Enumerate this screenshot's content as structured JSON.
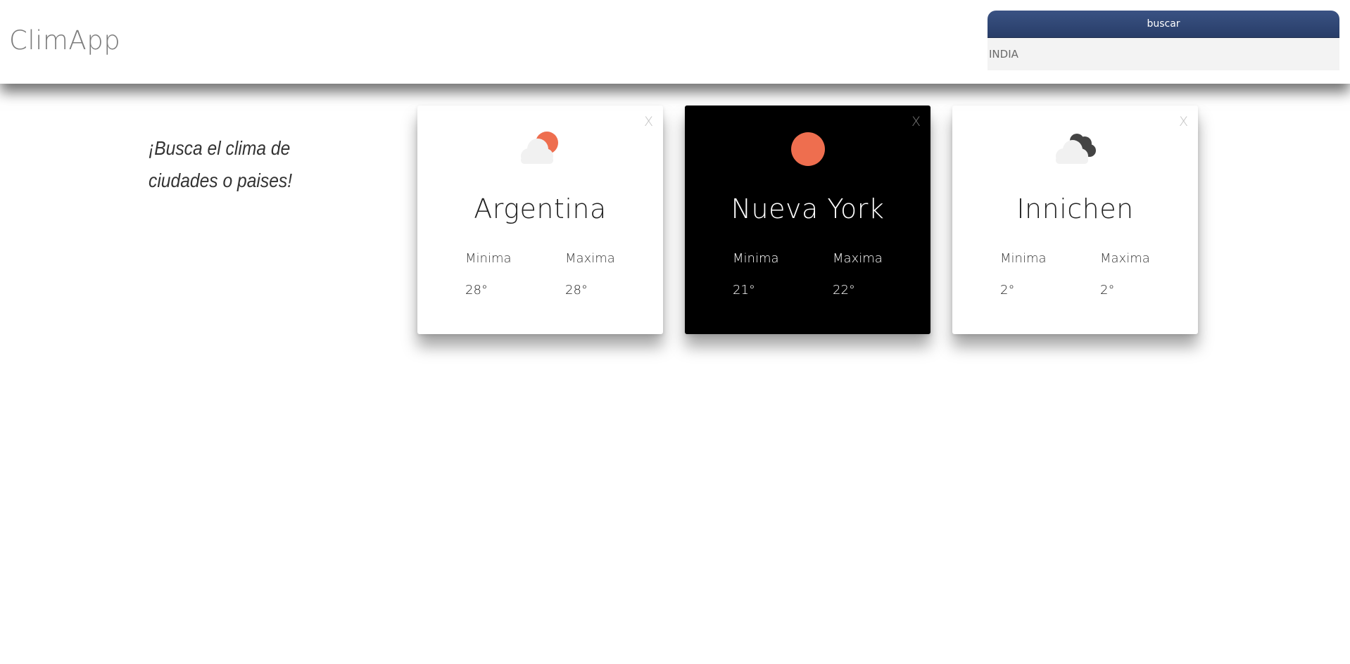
{
  "app": {
    "title": "ClimApp"
  },
  "search": {
    "button_label": "buscar",
    "value": "INDIA"
  },
  "tagline": "¡Busca el clima de ciudades o paises!",
  "colors": {
    "accent_sun": "#ee6e4f",
    "search_button": "#2f4574",
    "cloud": "#f1f1f1",
    "dark_cloud": "#444444"
  },
  "cards": [
    {
      "city": "Argentina",
      "theme": "light",
      "icon": "sun-behind-cloud-icon",
      "close_label": "X",
      "min_label": "Minima",
      "max_label": "Maxima",
      "min_value": "28°",
      "max_value": "28°"
    },
    {
      "city": "Nueva York",
      "theme": "dark",
      "icon": "sun-icon",
      "close_label": "X",
      "min_label": "Minima",
      "max_label": "Maxima",
      "min_value": "21°",
      "max_value": "22°"
    },
    {
      "city": "Innichen",
      "theme": "light",
      "icon": "cloudy-icon",
      "close_label": "X",
      "min_label": "Minima",
      "max_label": "Maxima",
      "min_value": "2°",
      "max_value": "2°"
    }
  ]
}
